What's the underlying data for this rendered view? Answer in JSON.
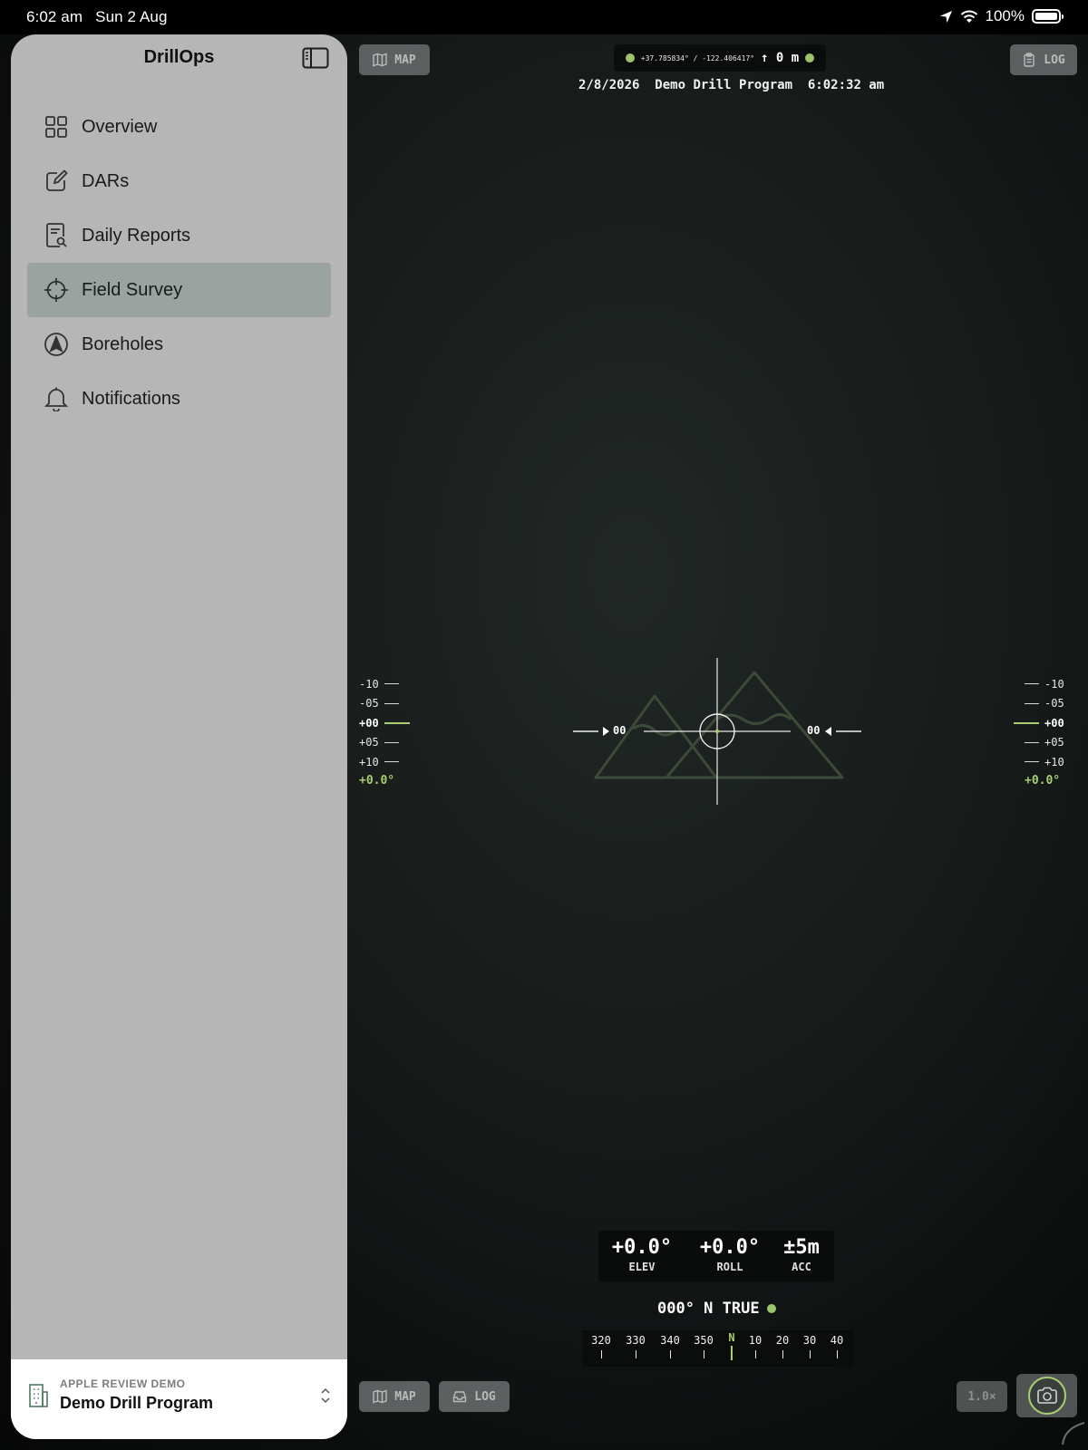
{
  "status_bar": {
    "time": "6:02 am",
    "date": "Sun 2 Aug",
    "battery": "100%"
  },
  "sidebar": {
    "title": "DrillOps",
    "items": [
      {
        "label": "Overview",
        "icon": "grid-icon",
        "active": false
      },
      {
        "label": "DARs",
        "icon": "edit-square-icon",
        "active": false
      },
      {
        "label": "Daily Reports",
        "icon": "report-search-icon",
        "active": false
      },
      {
        "label": "Field Survey",
        "icon": "crosshair-icon",
        "active": true
      },
      {
        "label": "Boreholes",
        "icon": "navigation-arrow-icon",
        "active": false
      },
      {
        "label": "Notifications",
        "icon": "bell-icon",
        "active": false
      }
    ],
    "footer": {
      "kicker": "APPLE REVIEW DEMO",
      "title": "Demo Drill Program"
    }
  },
  "hud": {
    "map_label": "MAP",
    "log_label": "LOG",
    "gps_coords": "+37.785834° / -122.406417°",
    "altitude": "↑ 0 m",
    "header_date": "2/8/2026",
    "header_program": "Demo Drill Program",
    "header_time": "6:02:32 am",
    "ladder_left": [
      "-10",
      "-05",
      "+00",
      "+05",
      "+10"
    ],
    "ladder_right": [
      "-10",
      "-05",
      "+00",
      "+05",
      "+10"
    ],
    "ladder_readout": "+0.0°",
    "roll_left": "00",
    "roll_right": "00",
    "elev_value": "+0.0°",
    "elev_label": "ELEV",
    "roll_value": "+0.0°",
    "roll_label": "ROLL",
    "acc_value": "±5m",
    "acc_label": "ACC",
    "heading": "000° N TRUE",
    "compass": [
      "320",
      "330",
      "340",
      "350",
      "N",
      "10",
      "20",
      "30",
      "40"
    ],
    "zoom": "1.0×"
  },
  "colors": {
    "accent": "#a7cf72",
    "sidebar_bg": "#b6b6b6",
    "active_item": "#9aa39f"
  }
}
